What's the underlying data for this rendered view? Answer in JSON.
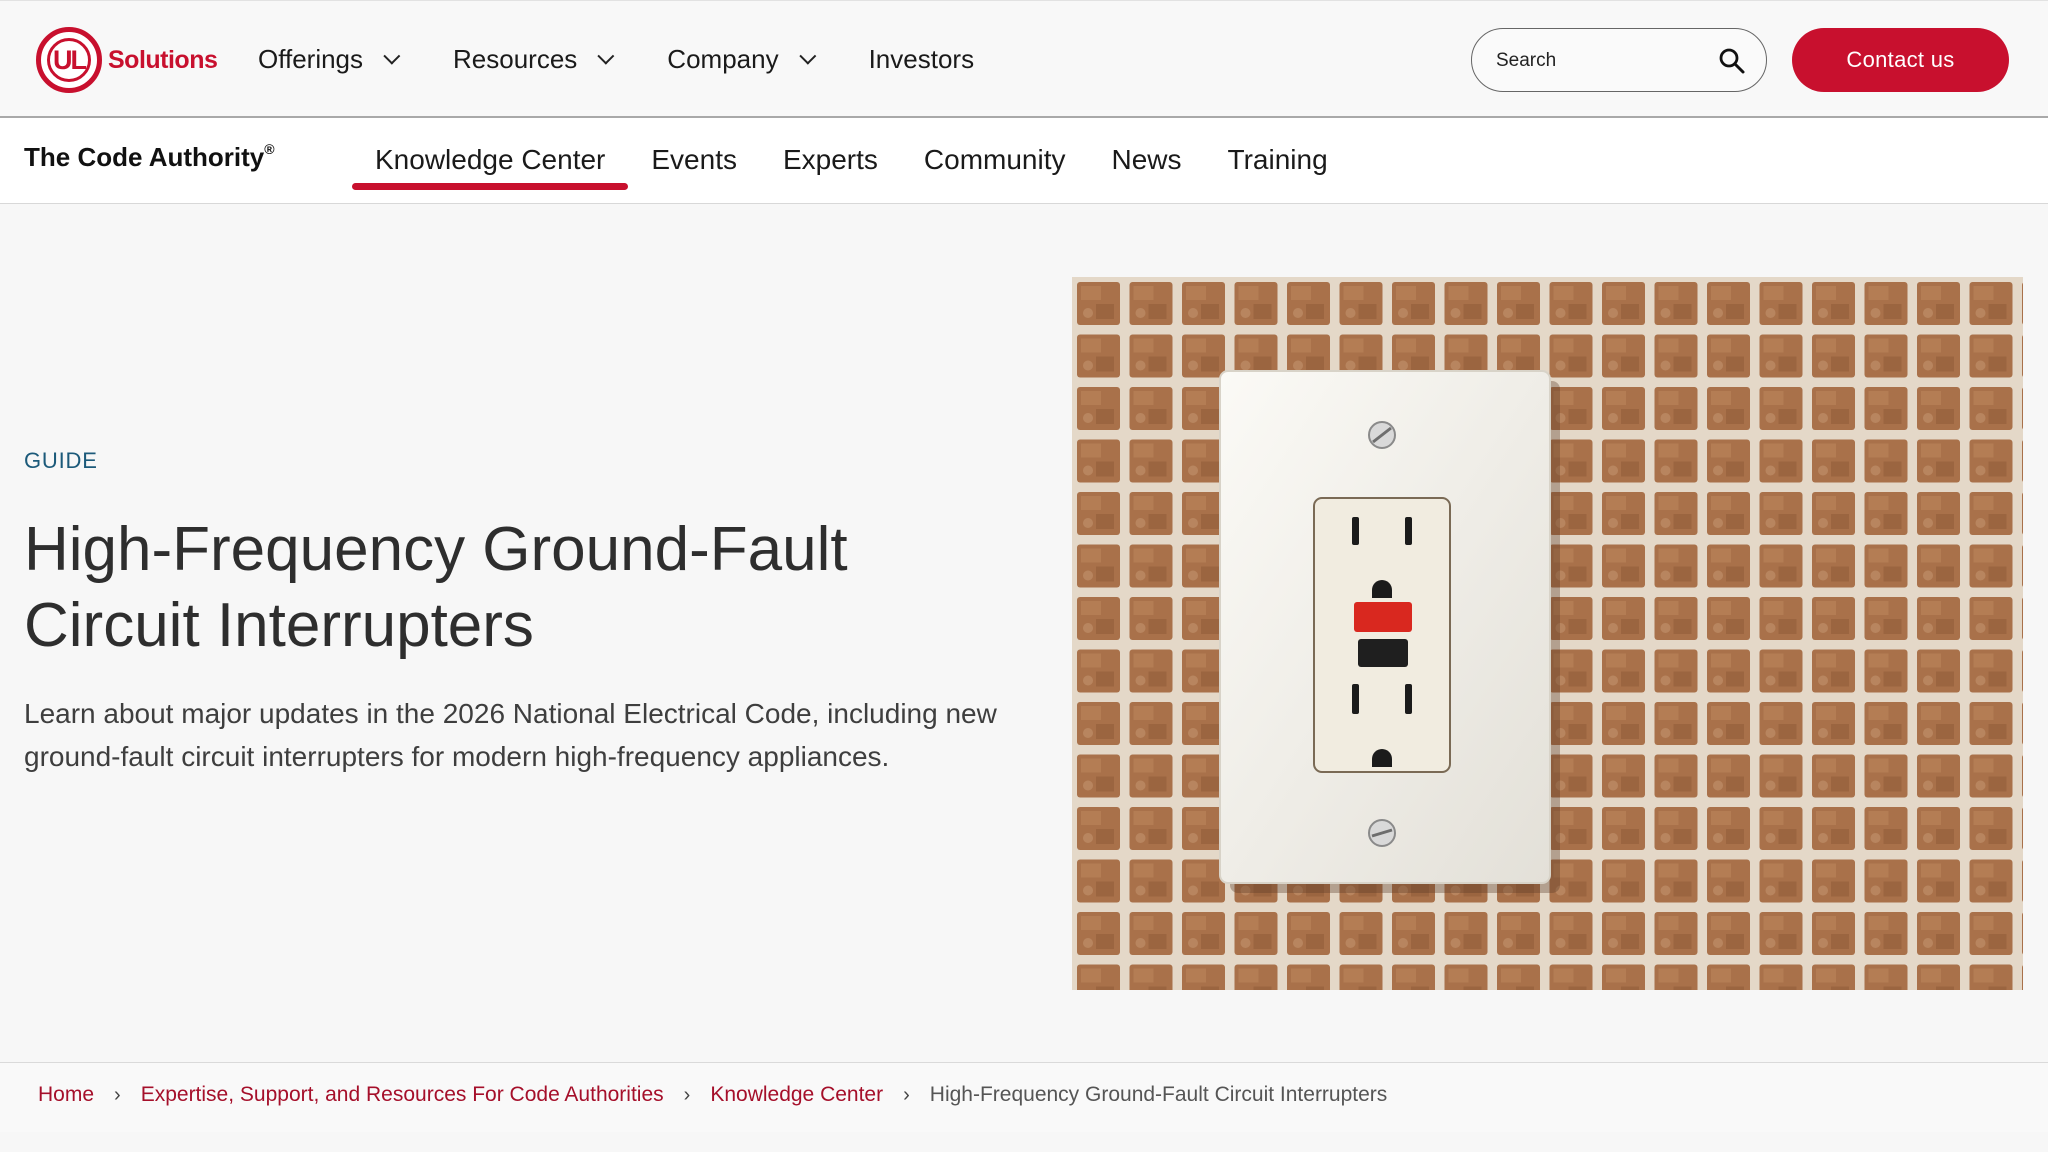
{
  "header": {
    "logo_text": "Solutions",
    "logo_mark": "UL",
    "nav": [
      {
        "label": "Offerings",
        "has_dropdown": true
      },
      {
        "label": "Resources",
        "has_dropdown": true
      },
      {
        "label": "Company",
        "has_dropdown": true
      },
      {
        "label": "Investors",
        "has_dropdown": false
      }
    ],
    "search_placeholder": "Search",
    "contact_label": "Contact us",
    "brand_color": "#c8102e"
  },
  "subnav": {
    "brand": "The Code Authority",
    "brand_mark": "®",
    "tabs": [
      {
        "label": "Knowledge Center",
        "active": true
      },
      {
        "label": "Events",
        "active": false
      },
      {
        "label": "Experts",
        "active": false
      },
      {
        "label": "Community",
        "active": false
      },
      {
        "label": "News",
        "active": false
      },
      {
        "label": "Training",
        "active": false
      }
    ]
  },
  "hero": {
    "eyebrow": "GUIDE",
    "title_line1": "High-Frequency Ground-Fault",
    "title_line2": "Circuit Interrupters",
    "description": "Learn about major updates in the 2026 National Electrical Code, including new ground-fault circuit interrupters for modern high-frequency appliances."
  },
  "breadcrumb": {
    "items": [
      {
        "label": "Home",
        "link": true
      },
      {
        "label": "Expertise, Support, and Resources For Code Authorities",
        "link": true
      },
      {
        "label": "Knowledge Center",
        "link": true
      },
      {
        "label": "High-Frequency Ground-Fault Circuit Interrupters",
        "link": false
      }
    ]
  }
}
